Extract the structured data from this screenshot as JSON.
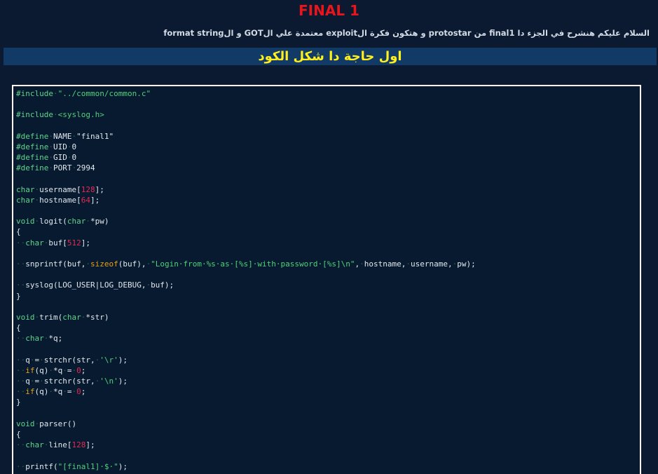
{
  "title": "FINAL 1",
  "intro": "السلام عليكم هنشرح في الجزء دا final1 من protostar و هتكون فكرة الexploit معتمدة علي الGOT و الformat string",
  "heading": "اول حاجة دا شكل الكود",
  "colors": {
    "background": "#0b1a30",
    "title": "#e8161c",
    "heading_bar": "#123a66",
    "heading_text": "#ffef1c",
    "keyword": "#5fd58a",
    "string": "#4fd17a",
    "number": "#e22a55",
    "builtin": "#e8a11a",
    "whitespace_marker": "#2f5d4d"
  },
  "code_lines": [
    [
      {
        "t": "kw",
        "v": "#include"
      },
      {
        "t": "ws",
        "v": "·"
      },
      {
        "t": "str",
        "v": "\"../common/common.c\""
      }
    ],
    [],
    [
      {
        "t": "kw",
        "v": "#include"
      },
      {
        "t": "ws",
        "v": "·"
      },
      {
        "t": "str",
        "v": "<syslog.h>"
      }
    ],
    [],
    [
      {
        "t": "kw",
        "v": "#define"
      },
      {
        "t": "ws",
        "v": "·"
      },
      {
        "t": "plain",
        "v": "NAME"
      },
      {
        "t": "ws",
        "v": "·"
      },
      {
        "t": "plain",
        "v": "\"final1\""
      }
    ],
    [
      {
        "t": "kw",
        "v": "#define"
      },
      {
        "t": "ws",
        "v": "·"
      },
      {
        "t": "plain",
        "v": "UID"
      },
      {
        "t": "ws",
        "v": "·"
      },
      {
        "t": "plain",
        "v": "0"
      }
    ],
    [
      {
        "t": "kw",
        "v": "#define"
      },
      {
        "t": "ws",
        "v": "·"
      },
      {
        "t": "plain",
        "v": "GID"
      },
      {
        "t": "ws",
        "v": "·"
      },
      {
        "t": "plain",
        "v": "0"
      }
    ],
    [
      {
        "t": "kw",
        "v": "#define"
      },
      {
        "t": "ws",
        "v": "·"
      },
      {
        "t": "plain",
        "v": "PORT"
      },
      {
        "t": "ws",
        "v": "·"
      },
      {
        "t": "plain",
        "v": "2994"
      }
    ],
    [],
    [
      {
        "t": "kw",
        "v": "char"
      },
      {
        "t": "ws",
        "v": "·"
      },
      {
        "t": "plain",
        "v": "username["
      },
      {
        "t": "num",
        "v": "128"
      },
      {
        "t": "plain",
        "v": "];"
      }
    ],
    [
      {
        "t": "kw",
        "v": "char"
      },
      {
        "t": "ws",
        "v": "·"
      },
      {
        "t": "plain",
        "v": "hostname["
      },
      {
        "t": "num",
        "v": "64"
      },
      {
        "t": "plain",
        "v": "];"
      }
    ],
    [],
    [
      {
        "t": "kw",
        "v": "void"
      },
      {
        "t": "ws",
        "v": "·"
      },
      {
        "t": "plain",
        "v": "logit("
      },
      {
        "t": "kw",
        "v": "char"
      },
      {
        "t": "ws",
        "v": "·"
      },
      {
        "t": "plain",
        "v": "*pw)"
      }
    ],
    [
      {
        "t": "plain",
        "v": "{"
      }
    ],
    [
      {
        "t": "ws",
        "v": "··"
      },
      {
        "t": "kw",
        "v": "char"
      },
      {
        "t": "ws",
        "v": "·"
      },
      {
        "t": "plain",
        "v": "buf["
      },
      {
        "t": "num",
        "v": "512"
      },
      {
        "t": "plain",
        "v": "];"
      }
    ],
    [],
    [
      {
        "t": "ws",
        "v": "··"
      },
      {
        "t": "plain",
        "v": "snprintf(buf,"
      },
      {
        "t": "ws",
        "v": "·"
      },
      {
        "t": "fn",
        "v": "sizeof"
      },
      {
        "t": "plain",
        "v": "(buf),"
      },
      {
        "t": "ws",
        "v": "·"
      },
      {
        "t": "str",
        "v": "\"Login·from·%s·as·[%s]·with·password·[%s]\\n\""
      },
      {
        "t": "plain",
        "v": ","
      },
      {
        "t": "ws",
        "v": "·"
      },
      {
        "t": "plain",
        "v": "hostname,"
      },
      {
        "t": "ws",
        "v": "·"
      },
      {
        "t": "plain",
        "v": "username,"
      },
      {
        "t": "ws",
        "v": "·"
      },
      {
        "t": "plain",
        "v": "pw);"
      }
    ],
    [],
    [
      {
        "t": "ws",
        "v": "··"
      },
      {
        "t": "plain",
        "v": "syslog(LOG_USER|LOG_DEBUG,"
      },
      {
        "t": "ws",
        "v": "·"
      },
      {
        "t": "plain",
        "v": "buf);"
      }
    ],
    [
      {
        "t": "plain",
        "v": "}"
      }
    ],
    [],
    [
      {
        "t": "kw",
        "v": "void"
      },
      {
        "t": "ws",
        "v": "·"
      },
      {
        "t": "plain",
        "v": "trim("
      },
      {
        "t": "kw",
        "v": "char"
      },
      {
        "t": "ws",
        "v": "·"
      },
      {
        "t": "plain",
        "v": "*str)"
      }
    ],
    [
      {
        "t": "plain",
        "v": "{"
      }
    ],
    [
      {
        "t": "ws",
        "v": "··"
      },
      {
        "t": "kw",
        "v": "char"
      },
      {
        "t": "ws",
        "v": "·"
      },
      {
        "t": "plain",
        "v": "*q;"
      }
    ],
    [],
    [
      {
        "t": "ws",
        "v": "··"
      },
      {
        "t": "plain",
        "v": "q"
      },
      {
        "t": "ws",
        "v": "·"
      },
      {
        "t": "plain",
        "v": "="
      },
      {
        "t": "ws",
        "v": "·"
      },
      {
        "t": "plain",
        "v": "strchr(str,"
      },
      {
        "t": "ws",
        "v": "·"
      },
      {
        "t": "str",
        "v": "'\\r'"
      },
      {
        "t": "plain",
        "v": ");"
      }
    ],
    [
      {
        "t": "ws",
        "v": "··"
      },
      {
        "t": "fn",
        "v": "if"
      },
      {
        "t": "plain",
        "v": "(q)"
      },
      {
        "t": "ws",
        "v": "·"
      },
      {
        "t": "plain",
        "v": "*q"
      },
      {
        "t": "ws",
        "v": "·"
      },
      {
        "t": "plain",
        "v": "="
      },
      {
        "t": "ws",
        "v": "·"
      },
      {
        "t": "num",
        "v": "0"
      },
      {
        "t": "plain",
        "v": ";"
      }
    ],
    [
      {
        "t": "ws",
        "v": "··"
      },
      {
        "t": "plain",
        "v": "q"
      },
      {
        "t": "ws",
        "v": "·"
      },
      {
        "t": "plain",
        "v": "="
      },
      {
        "t": "ws",
        "v": "·"
      },
      {
        "t": "plain",
        "v": "strchr(str,"
      },
      {
        "t": "ws",
        "v": "·"
      },
      {
        "t": "str",
        "v": "'\\n'"
      },
      {
        "t": "plain",
        "v": ");"
      }
    ],
    [
      {
        "t": "ws",
        "v": "··"
      },
      {
        "t": "fn",
        "v": "if"
      },
      {
        "t": "plain",
        "v": "(q)"
      },
      {
        "t": "ws",
        "v": "·"
      },
      {
        "t": "plain",
        "v": "*q"
      },
      {
        "t": "ws",
        "v": "·"
      },
      {
        "t": "plain",
        "v": "="
      },
      {
        "t": "ws",
        "v": "·"
      },
      {
        "t": "num",
        "v": "0"
      },
      {
        "t": "plain",
        "v": ";"
      }
    ],
    [
      {
        "t": "plain",
        "v": "}"
      }
    ],
    [],
    [
      {
        "t": "kw",
        "v": "void"
      },
      {
        "t": "ws",
        "v": "·"
      },
      {
        "t": "plain",
        "v": "parser()"
      }
    ],
    [
      {
        "t": "plain",
        "v": "{"
      }
    ],
    [
      {
        "t": "ws",
        "v": "··"
      },
      {
        "t": "kw",
        "v": "char"
      },
      {
        "t": "ws",
        "v": "·"
      },
      {
        "t": "plain",
        "v": "line["
      },
      {
        "t": "num",
        "v": "128"
      },
      {
        "t": "plain",
        "v": "];"
      }
    ],
    [],
    [
      {
        "t": "ws",
        "v": "··"
      },
      {
        "t": "plain",
        "v": "printf("
      },
      {
        "t": "str",
        "v": "\"[final1]·$·\""
      },
      {
        "t": "plain",
        "v": ");"
      }
    ]
  ]
}
